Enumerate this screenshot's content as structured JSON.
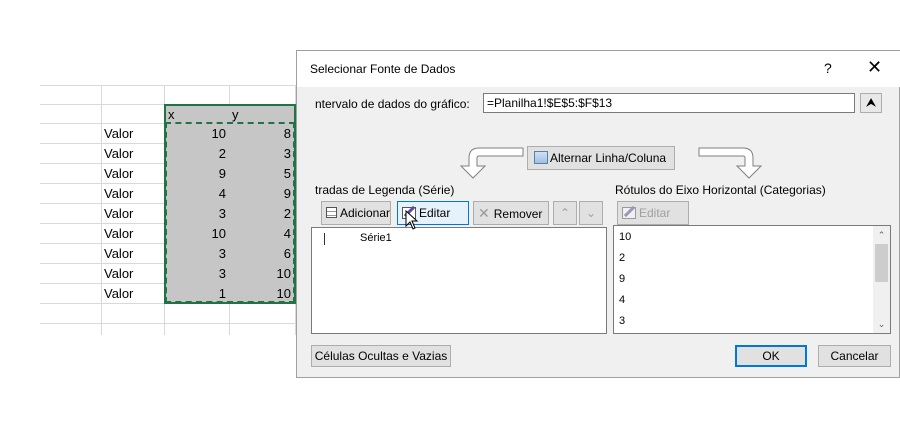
{
  "sheet": {
    "header": {
      "x": "x",
      "y": "y"
    },
    "rows": [
      {
        "label": "Valor",
        "x": "10",
        "y": "8"
      },
      {
        "label": "Valor",
        "x": "2",
        "y": "3"
      },
      {
        "label": "Valor",
        "x": "9",
        "y": "5"
      },
      {
        "label": "Valor",
        "x": "4",
        "y": "9"
      },
      {
        "label": "Valor",
        "x": "3",
        "y": "2"
      },
      {
        "label": "Valor",
        "x": "10",
        "y": "4"
      },
      {
        "label": "Valor",
        "x": "3",
        "y": "6"
      },
      {
        "label": "Valor",
        "x": "3",
        "y": "10"
      },
      {
        "label": "Valor",
        "x": "1",
        "y": "10"
      }
    ]
  },
  "dialog": {
    "title": "Selecionar Fonte de Dados",
    "help": "?",
    "close": "✕",
    "range_label": "ntervalo de dados do gráfico:",
    "range_value": "=Planilha1!$E$5:$F$13",
    "range_collapse_icon": "⮝",
    "switch_label": "Alternar Linha/Coluna",
    "legend_title": "tradas de Legenda (Série)",
    "axis_title": "Rótulos do Eixo Horizontal (Categorias)",
    "legend_buttons": {
      "add": "Adicionar",
      "edit": "Editar",
      "remove": "Remover",
      "up": "⌃",
      "down": "⌄"
    },
    "axis_edit": "Editar",
    "series": [
      "Série1"
    ],
    "categories": [
      "10",
      "2",
      "9",
      "4",
      "3"
    ],
    "scroll_up": "⌃",
    "scroll_down": "⌄",
    "hidden_cells": "Células Ocultas e Vazias",
    "ok": "OK",
    "cancel": "Cancelar"
  }
}
